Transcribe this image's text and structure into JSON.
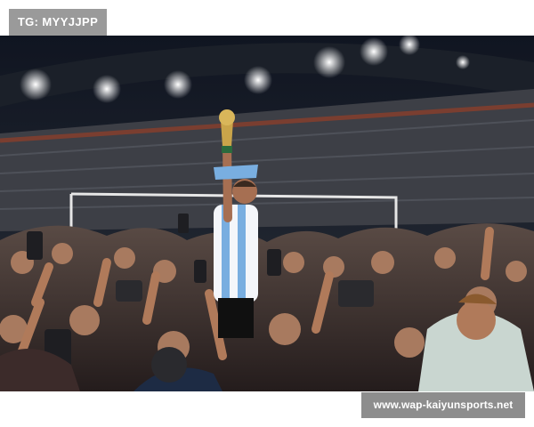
{
  "overlay": {
    "tag_text": "TG: MYYJJPP",
    "site_text": "www.wap-kaiyunsports.net"
  },
  "photo": {
    "subject": "player-with-trophy",
    "setting": "stadium-celebration-crowd",
    "colors": {
      "sky_dark": "#121722",
      "stands": "#3b3d43",
      "lights": "#ffffff",
      "jersey_blue": "#7fb3e0",
      "trophy_gold": "#c9a44a",
      "crowd_skin": "#b07a5a"
    }
  }
}
